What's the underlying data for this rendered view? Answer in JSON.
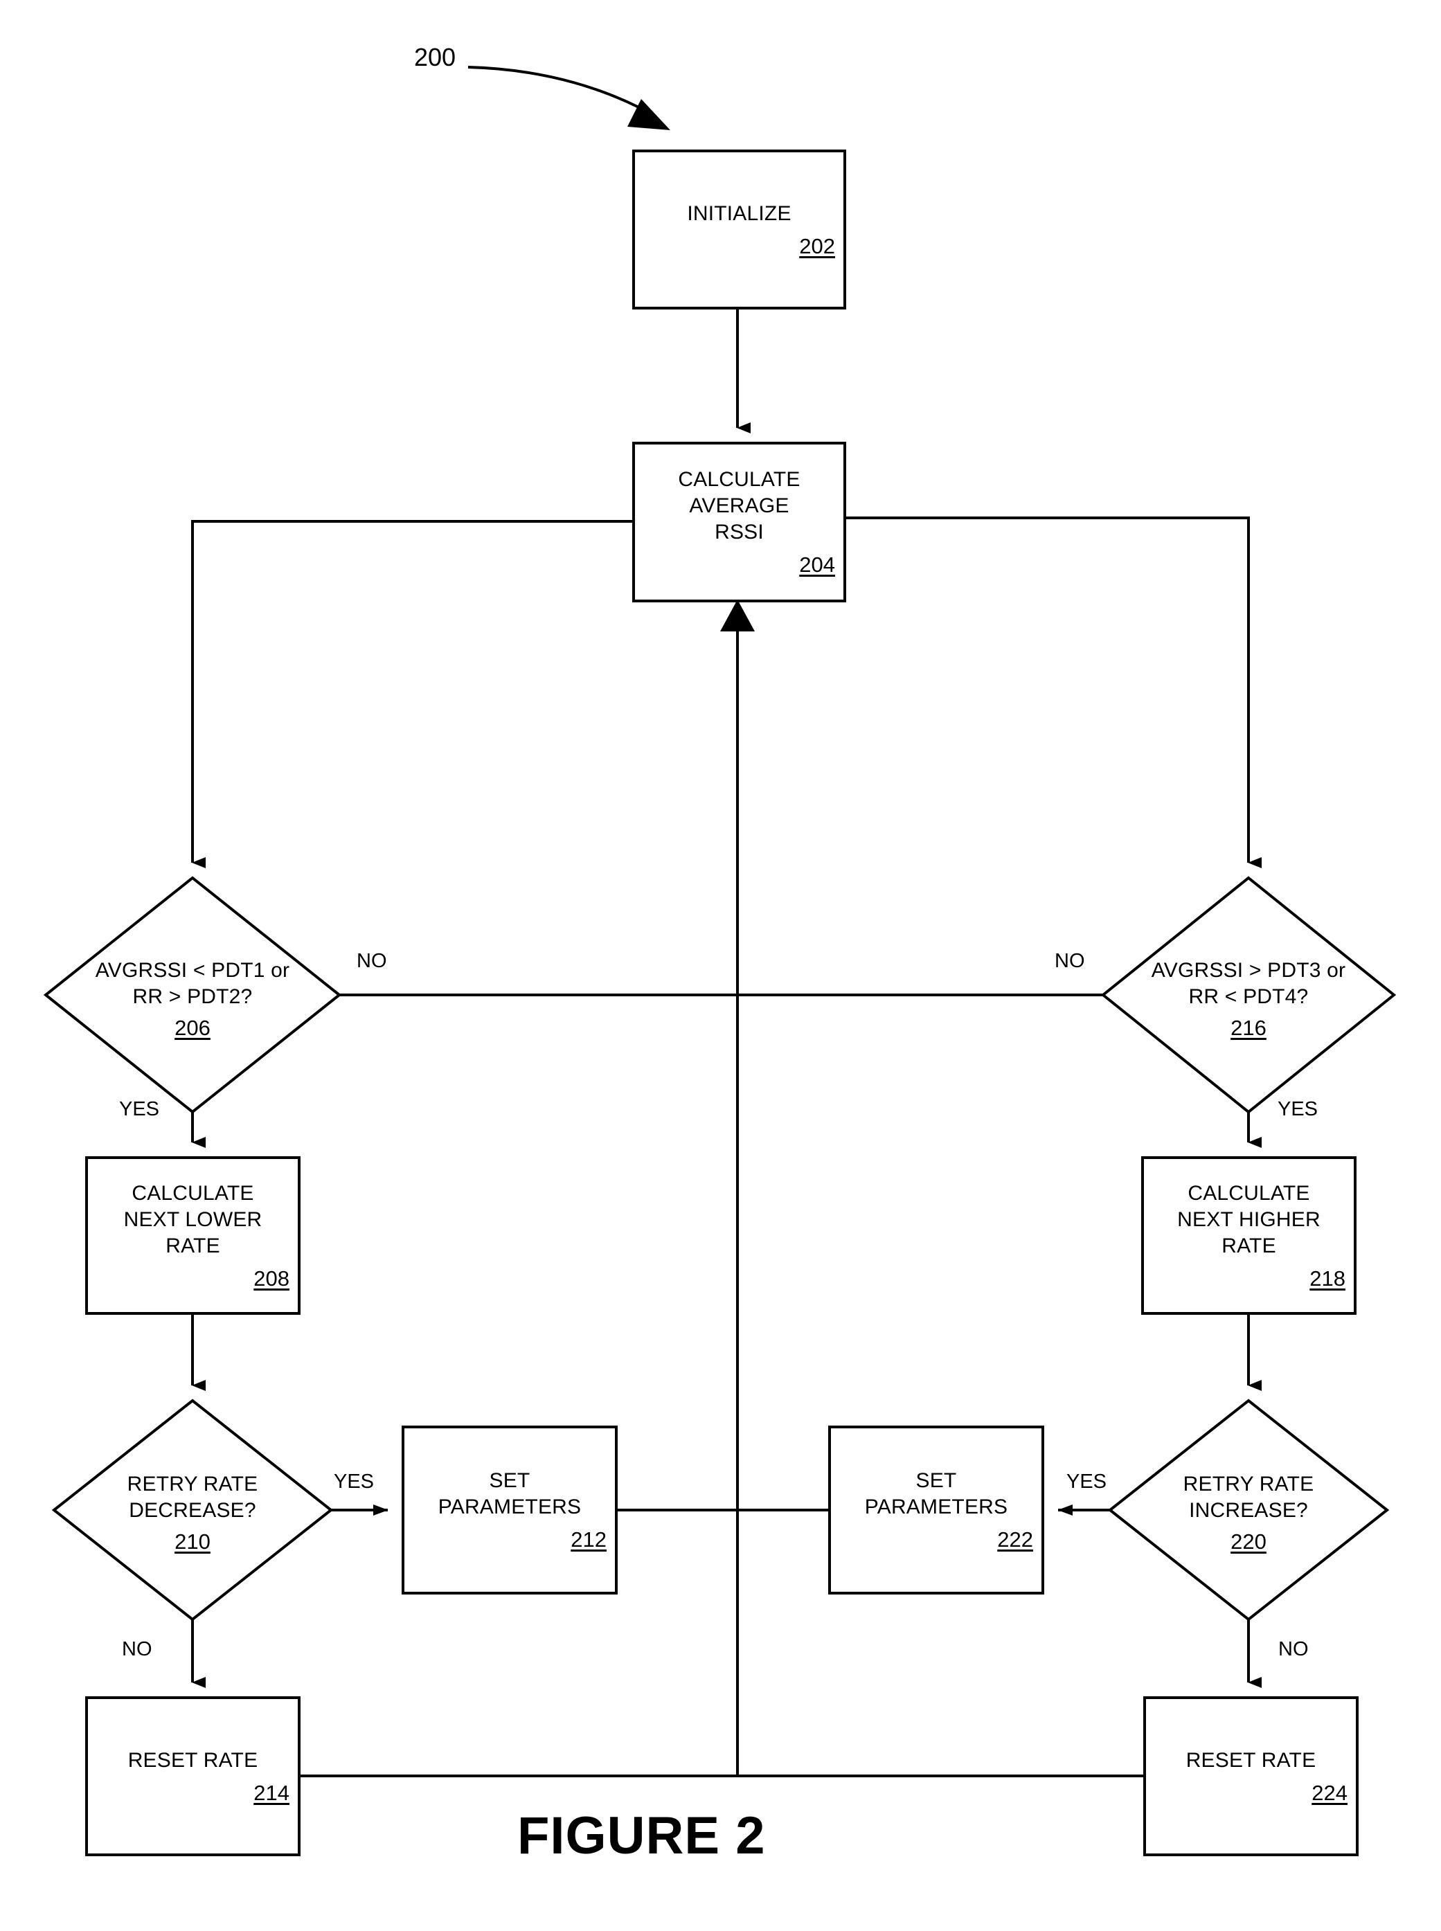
{
  "figure": {
    "caption": "FIGURE 2",
    "flow_reference": "200"
  },
  "nodes": [
    {
      "id": "initialize",
      "shape": "process",
      "text": "INITIALIZE",
      "ref": "202"
    },
    {
      "id": "calculate-average-rssi",
      "shape": "process",
      "text": "CALCULATE\nAVERAGE\nRSSI",
      "ref": "204"
    },
    {
      "id": "avgrssi-lower-test",
      "shape": "decision",
      "text": "AVGRSSI < PDT1 or\nRR > PDT2?",
      "ref": "206"
    },
    {
      "id": "calculate-next-lower-rate",
      "shape": "process",
      "text": "CALCULATE\nNEXT LOWER\nRATE",
      "ref": "208"
    },
    {
      "id": "retry-rate-decrease-test",
      "shape": "decision",
      "text": "RETRY RATE\nDECREASE?",
      "ref": "210"
    },
    {
      "id": "set-parameters-left",
      "shape": "process",
      "text": "SET\nPARAMETERS",
      "ref": "212"
    },
    {
      "id": "reset-rate-left",
      "shape": "process",
      "text": "RESET RATE",
      "ref": "214"
    },
    {
      "id": "avgrssi-higher-test",
      "shape": "decision",
      "text": "AVGRSSI > PDT3 or\nRR < PDT4?",
      "ref": "216"
    },
    {
      "id": "calculate-next-higher-rate",
      "shape": "process",
      "text": "CALCULATE\nNEXT HIGHER\nRATE",
      "ref": "218"
    },
    {
      "id": "retry-rate-increase-test",
      "shape": "decision",
      "text": "RETRY RATE\nINCREASE?",
      "ref": "220"
    },
    {
      "id": "set-parameters-right",
      "shape": "process",
      "text": "SET\nPARAMETERS",
      "ref": "222"
    },
    {
      "id": "reset-rate-right",
      "shape": "process",
      "text": "RESET RATE",
      "ref": "224"
    }
  ],
  "edge_labels": {
    "no_left": "NO",
    "no_right": "NO",
    "yes_206": "YES",
    "yes_216": "YES",
    "yes_210": "YES",
    "yes_220": "YES",
    "no_210": "NO",
    "no_220": "NO"
  },
  "style": {
    "stroke": "#000000",
    "fill": "#ffffff",
    "background": "#ffffff"
  }
}
